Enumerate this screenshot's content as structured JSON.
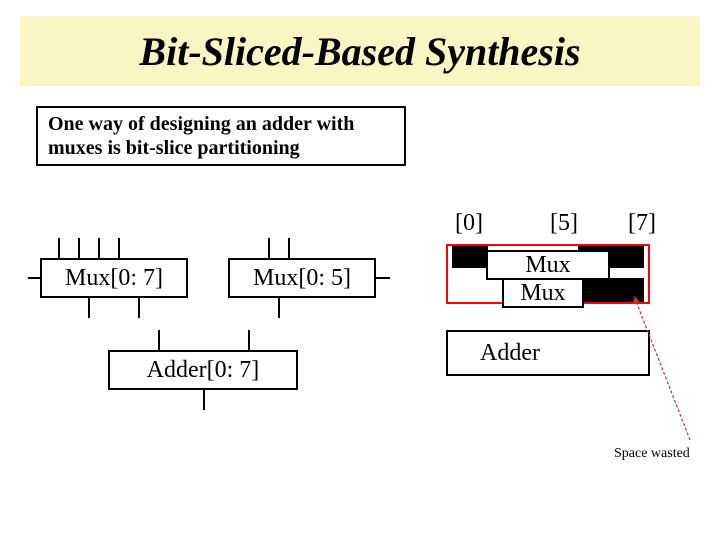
{
  "title": "Bit-Sliced-Based Synthesis",
  "subtitle": "One way of designing an adder with muxes is bit-slice partitioning",
  "left": {
    "muxA": "Mux[0: 7]",
    "muxB": "Mux[0: 5]",
    "adder": "Adder[0: 7]"
  },
  "right": {
    "idx0": "[0]",
    "idx5": "[5]",
    "idx7": "[7]",
    "muxTop": "Mux",
    "muxBottom": "Mux",
    "adder": "Adder"
  },
  "note": "Space wasted"
}
